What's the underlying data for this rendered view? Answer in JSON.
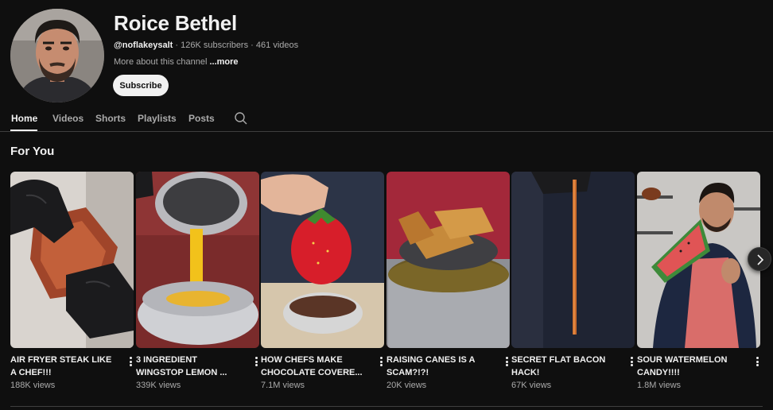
{
  "channel": {
    "name": "Roice Bethel",
    "handle": "@noflakeysalt",
    "subscribers": "126K subscribers",
    "videos": "461 videos",
    "about": "More about this channel",
    "more_link": "...more",
    "subscribe_label": "Subscribe"
  },
  "tabs": [
    {
      "label": "Home",
      "active": true
    },
    {
      "label": "Videos"
    },
    {
      "label": "Shorts"
    },
    {
      "label": "Playlists"
    },
    {
      "label": "Posts"
    }
  ],
  "section": {
    "title": "For You"
  },
  "videos": [
    {
      "title": "AIR FRYER STEAK LIKE A CHEF!!!",
      "views": "188K views"
    },
    {
      "title": "3 INGREDIENT WINGSTOP LEMON ...",
      "views": "339K views"
    },
    {
      "title": "HOW CHEFS MAKE CHOCOLATE COVERE...",
      "views": "7.1M views"
    },
    {
      "title": "RAISING CANES IS A SCAM?!?!",
      "views": "20K views"
    },
    {
      "title": "SECRET FLAT BACON HACK!",
      "views": "67K views"
    },
    {
      "title": "SOUR WATERMELON CANDY!!!!",
      "views": "1.8M views"
    }
  ],
  "colors": {
    "background": "#0f0f0f",
    "text_primary": "#f1f1f1",
    "text_secondary": "#aaaaaa",
    "divider": "#3f3f3f"
  },
  "icons": {
    "search": "search-icon",
    "more": "more-vert-icon",
    "next": "chevron-right-icon"
  }
}
